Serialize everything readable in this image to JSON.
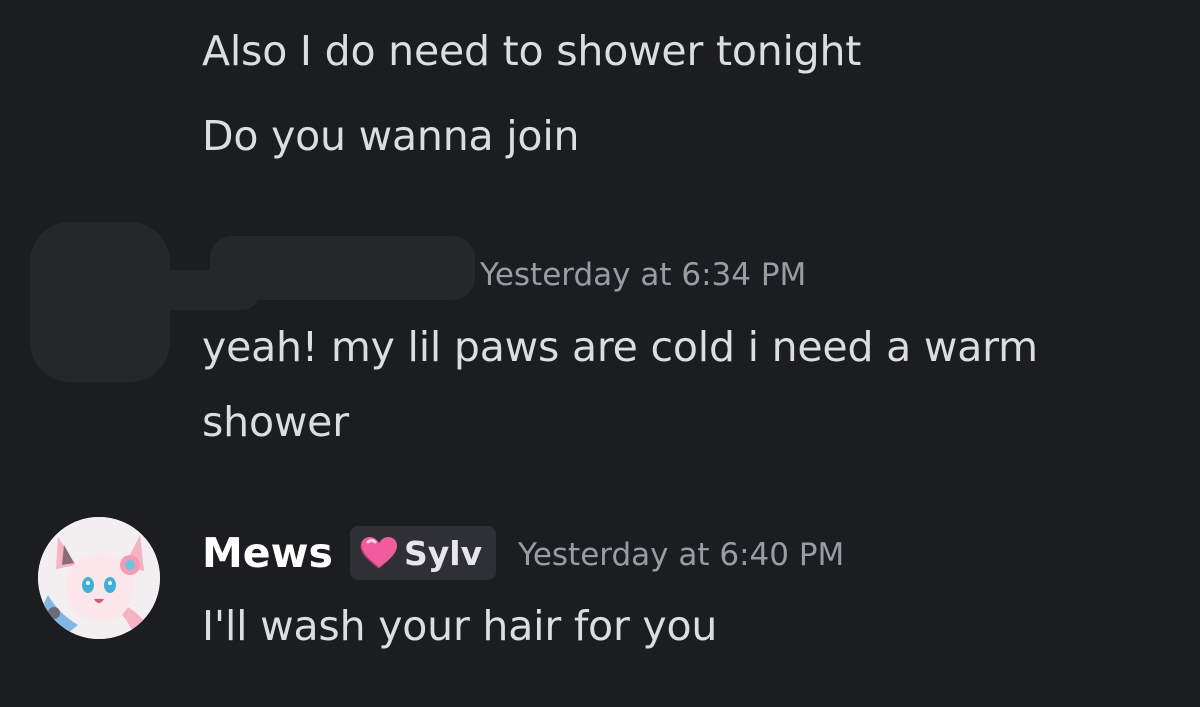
{
  "messages": {
    "top_line_1": "Also I do need to shower tonight",
    "top_line_2": "Do you wanna join",
    "reply_timestamp": "Yesterday at 6:34 PM",
    "reply_line_1": "yeah! my lil paws are cold i need a warm",
    "reply_line_2": "shower",
    "author": {
      "name": "Mews",
      "tag_icon": "pink-heart-icon",
      "tag_label": "Sylv",
      "timestamp": "Yesterday at 6:40 PM"
    },
    "last_line": "I'll wash your hair for you"
  },
  "colors": {
    "background": "#1c1d21",
    "message_text": "#dcdde1",
    "timestamp": "#9a9ca3",
    "username": "#ffffff",
    "tag_bg": "#2f3036",
    "heart": "#f25c9c"
  }
}
